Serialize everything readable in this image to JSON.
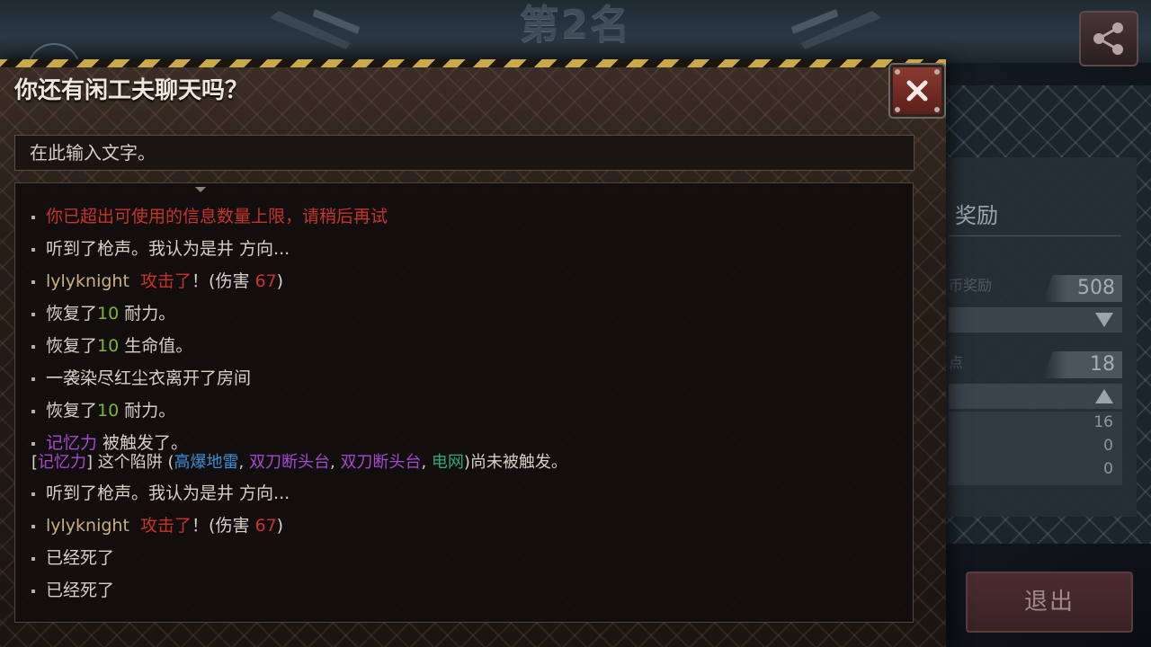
{
  "background": {
    "rank_title": "第2名",
    "reward_header": "奖励",
    "coin_reward_label": "币奖励",
    "coin_reward_value": "508",
    "points_label": "点",
    "points_value": "18",
    "stat_values": [
      "16",
      "0",
      "0"
    ],
    "stat_sublabel": "奖励",
    "exit_label": "退出",
    "share_icon": "share-icon"
  },
  "chat": {
    "title": "你还有闲工夫聊天吗？",
    "input_placeholder": "在此输入文字。",
    "close_icon": "close-icon",
    "colors": {
      "system_warning": "#c8332a",
      "number": "#7fb531",
      "player_name": "#c9b07c",
      "trap_purple": "#a34ad1",
      "trap_blue": "#3c8fd6",
      "trap_teal": "#2fa879"
    },
    "messages": [
      {
        "text": "你已超出可使用的信息数量上限，请稍后再试"
      },
      {
        "text": "听到了枪声。我认为是井 方向..."
      },
      {
        "player": "lylyknight",
        "action": "攻击了",
        "pre": "！(伤害 ",
        "damage": "67",
        "post": ")"
      },
      {
        "pre": "恢复了",
        "num": "10",
        "post": " 耐力。"
      },
      {
        "pre": "恢复了",
        "num": "10",
        "post": " 生命值。"
      },
      {
        "text": "一袭染尽红尘衣离开了房间"
      },
      {
        "pre": "恢复了",
        "num": "10",
        "post": " 耐力。"
      },
      {
        "skill": "记忆力",
        "post": " 被触发了。"
      },
      {
        "open": "[",
        "skill": "记忆力",
        "close": "] 这个陷阱 (",
        "trap1": "高爆地雷",
        "sep1": ", ",
        "trap2": "双刀断头台",
        "sep2": ", ",
        "trap3": "双刀断头台",
        "sep3": ", ",
        "trap4": "电网",
        "post": ")尚未被触发。"
      },
      {
        "text": "听到了枪声。我认为是井 方向..."
      },
      {
        "player": "lylyknight",
        "action": "攻击了",
        "pre": "！(伤害 ",
        "damage": "67",
        "post": ")"
      },
      {
        "text": "已经死了"
      },
      {
        "text": "已经死了"
      },
      {
        "text": "..."
      }
    ]
  }
}
